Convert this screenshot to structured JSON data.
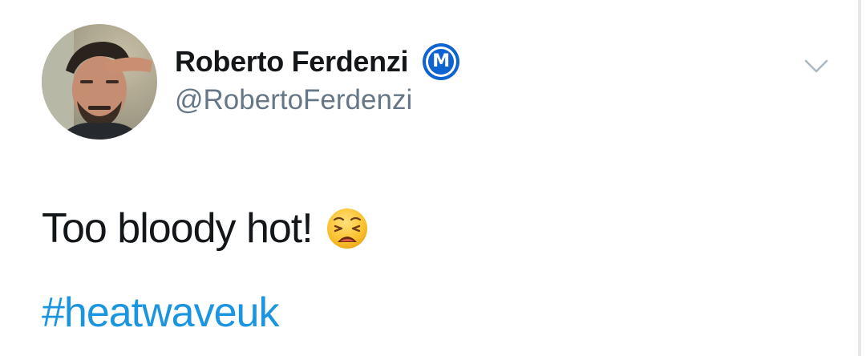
{
  "user": {
    "display_name": "Roberto Ferdenzi",
    "handle": "@RobertoFerdenzi",
    "badge_letter": "M",
    "badge_color": "#0d63d1"
  },
  "tweet": {
    "text": "Too bloody hot!",
    "emoji": "weary-face-icon",
    "hashtag": "#heatwaveuk",
    "hashtag_color": "#1b95e0"
  },
  "icons": {
    "menu": "chevron-down-icon"
  }
}
